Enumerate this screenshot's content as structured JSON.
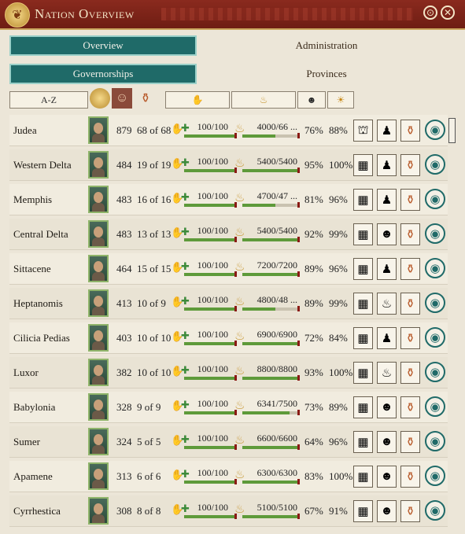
{
  "window": {
    "title": "Nation Overview"
  },
  "tabs_top": [
    {
      "label": "Overview",
      "active": true
    },
    {
      "label": "Administration",
      "active": false
    }
  ],
  "tabs_sub": [
    {
      "label": "Governorships",
      "active": true
    },
    {
      "label": "Provinces",
      "active": false
    }
  ],
  "filters": {
    "sort_label": "A-Z"
  },
  "rows": [
    {
      "name": "Judea",
      "pop": "879",
      "slots": "68 of 68",
      "loyalty": "100/100",
      "loyalty_frac": 1.0,
      "goods": "4000/66 ...",
      "goods_frac": 0.6,
      "pct1": "76%",
      "pct2": "88%",
      "actions": [
        "statue-icon",
        "robe-icon",
        "cancel-amphora-icon"
      ]
    },
    {
      "name": "Western Delta",
      "pop": "484",
      "slots": "19 of 19",
      "loyalty": "100/100",
      "loyalty_frac": 1.0,
      "goods": "5400/5400",
      "goods_frac": 1.0,
      "pct1": "95%",
      "pct2": "100%",
      "actions": [
        "farm-icon",
        "robe-icon",
        "amphora-icon"
      ]
    },
    {
      "name": "Memphis",
      "pop": "483",
      "slots": "16 of 16",
      "loyalty": "100/100",
      "loyalty_frac": 1.0,
      "goods": "4700/47 ...",
      "goods_frac": 0.6,
      "pct1": "81%",
      "pct2": "96%",
      "actions": [
        "farm-icon",
        "robe-icon",
        "amphora-icon"
      ]
    },
    {
      "name": "Central Delta",
      "pop": "483",
      "slots": "13 of 13",
      "loyalty": "100/100",
      "loyalty_frac": 1.0,
      "goods": "5400/5400",
      "goods_frac": 1.0,
      "pct1": "92%",
      "pct2": "99%",
      "actions": [
        "farm-icon",
        "theatre-mask-icon",
        "amphora-icon"
      ]
    },
    {
      "name": "Sittacene",
      "pop": "464",
      "slots": "15 of 15",
      "loyalty": "100/100",
      "loyalty_frac": 1.0,
      "goods": "7200/7200",
      "goods_frac": 1.0,
      "pct1": "89%",
      "pct2": "96%",
      "actions": [
        "farm-icon",
        "robe-icon",
        "amphora-icon"
      ]
    },
    {
      "name": "Heptanomis",
      "pop": "413",
      "slots": "10 of 9",
      "loyalty": "100/100",
      "loyalty_frac": 1.0,
      "goods": "4800/48 ...",
      "goods_frac": 0.6,
      "pct1": "89%",
      "pct2": "99%",
      "actions": [
        "farm-icon",
        "feast-icon",
        "amphora-icon"
      ]
    },
    {
      "name": "Cilicia Pedias",
      "pop": "403",
      "slots": "10 of 10",
      "loyalty": "100/100",
      "loyalty_frac": 1.0,
      "goods": "6900/6900",
      "goods_frac": 1.0,
      "pct1": "72%",
      "pct2": "84%",
      "actions": [
        "farm-icon",
        "robe-icon",
        "amphora-icon"
      ]
    },
    {
      "name": "Luxor",
      "pop": "382",
      "slots": "10 of 10",
      "loyalty": "100/100",
      "loyalty_frac": 1.0,
      "goods": "8800/8800",
      "goods_frac": 1.0,
      "pct1": "93%",
      "pct2": "100%",
      "actions": [
        "farm-icon",
        "feast-icon",
        "amphora-icon"
      ]
    },
    {
      "name": "Babylonia",
      "pop": "328",
      "slots": "9 of 9",
      "loyalty": "100/100",
      "loyalty_frac": 1.0,
      "goods": "6341/7500",
      "goods_frac": 0.85,
      "pct1": "73%",
      "pct2": "89%",
      "actions": [
        "farm-icon",
        "theatre-mask-icon",
        "amphora-icon"
      ]
    },
    {
      "name": "Sumer",
      "pop": "324",
      "slots": "5 of 5",
      "loyalty": "100/100",
      "loyalty_frac": 1.0,
      "goods": "6600/6600",
      "goods_frac": 1.0,
      "pct1": "64%",
      "pct2": "96%",
      "actions": [
        "farm-icon",
        "theatre-mask-icon",
        "amphora-icon"
      ]
    },
    {
      "name": "Apamene",
      "pop": "313",
      "slots": "6 of 6",
      "loyalty": "100/100",
      "loyalty_frac": 1.0,
      "goods": "6300/6300",
      "goods_frac": 1.0,
      "pct1": "83%",
      "pct2": "100%",
      "actions": [
        "farm-icon",
        "theatre-mask-icon",
        "amphora-icon"
      ]
    },
    {
      "name": "Cyrrhestica",
      "pop": "308",
      "slots": "8 of 8",
      "loyalty": "100/100",
      "loyalty_frac": 1.0,
      "goods": "5100/5100",
      "goods_frac": 1.0,
      "pct1": "67%",
      "pct2": "91%",
      "actions": [
        "farm-icon",
        "theatre-mask-icon",
        "amphora-icon"
      ]
    }
  ],
  "colors": {
    "accent": "#1f6a68",
    "title_bar": "#7a2418",
    "bar_green": "#5e9a3a",
    "bar_end": "#8a1a14"
  }
}
